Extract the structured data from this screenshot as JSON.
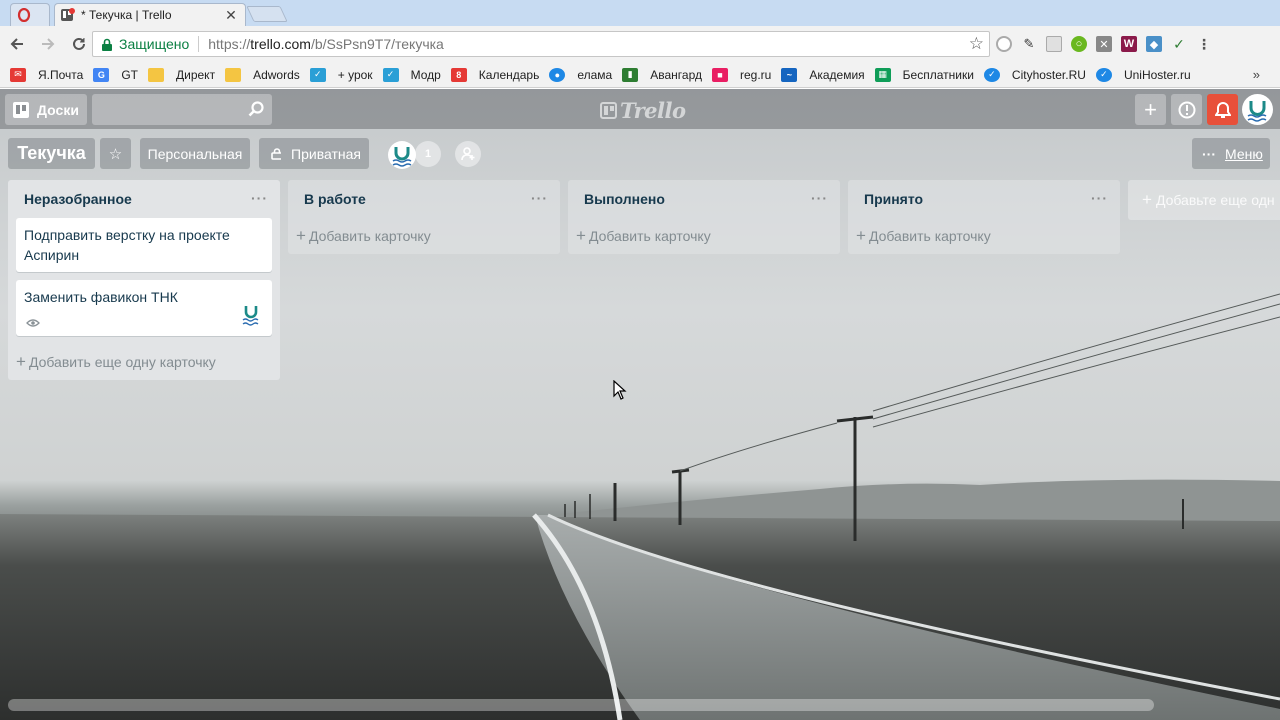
{
  "browser": {
    "tabs": [
      {
        "title": "",
        "active": false
      },
      {
        "title": "* Текучка | Trello",
        "active": true
      }
    ],
    "address": {
      "secure_label": "Защищено",
      "url_prefix": "https://",
      "url_host": "trello.com",
      "url_path": "/b/SsPsn9T7/текучка"
    },
    "bookmarks": [
      {
        "label": "Я.Почта",
        "icon": "mail-icon",
        "color": "#e53935"
      },
      {
        "label": "GT",
        "icon": "translate-icon",
        "color": "#4285f4"
      },
      {
        "label": "Директ",
        "icon": "folder-icon",
        "color": "#f4c542"
      },
      {
        "label": "Adwords",
        "icon": "folder-icon",
        "color": "#f4c542"
      },
      {
        "label": "+ урок",
        "icon": "check-icon",
        "color": "#2a9fd6"
      },
      {
        "label": "Модр",
        "icon": "check-icon",
        "color": "#2a9fd6"
      },
      {
        "label": "Календарь",
        "icon": "calendar-icon",
        "color": "#e53935"
      },
      {
        "label": "елама",
        "icon": "globe-icon",
        "color": "#1e88e5"
      },
      {
        "label": "Авангард",
        "icon": "door-icon",
        "color": "#2e7d32"
      },
      {
        "label": "reg.ru",
        "icon": "cube-icon",
        "color": "#e91e63"
      },
      {
        "label": "Академия",
        "icon": "wave-icon",
        "color": "#1565c0"
      },
      {
        "label": "Бесплатники",
        "icon": "sheet-icon",
        "color": "#0f9d58"
      },
      {
        "label": "Cityhoster.RU",
        "icon": "check-circle-icon",
        "color": "#1e88e5"
      },
      {
        "label": "UniHoster.ru",
        "icon": "check-circle-icon",
        "color": "#1e88e5"
      }
    ],
    "bookmarks_more": "»"
  },
  "trello": {
    "header": {
      "boards_label": "Доски",
      "logo_text": "Trello"
    },
    "board": {
      "title": "Текучка",
      "team_label": "Персональная",
      "visibility_label": "Приватная",
      "member_count": "1",
      "menu_label": "Меню"
    },
    "lists": [
      {
        "name": "Неразобранное",
        "cards": [
          {
            "title": "Подправить верстку на проекте Аспирин",
            "watched": false,
            "has_member": false
          },
          {
            "title": "Заменить фавикон ТНК",
            "watched": true,
            "has_member": true
          }
        ],
        "add_label": "Добавить еще одну карточку"
      },
      {
        "name": "В работе",
        "cards": [],
        "add_label": "Добавить карточку"
      },
      {
        "name": "Выполнено",
        "cards": [],
        "add_label": "Добавить карточку"
      },
      {
        "name": "Принято",
        "cards": [],
        "add_label": "Добавить карточку"
      }
    ],
    "add_list_label": "Добавьте еще одн",
    "list_menu_glyph": "···"
  },
  "colors": {
    "notification": "#e8503a",
    "secure_green": "#0b8043"
  }
}
